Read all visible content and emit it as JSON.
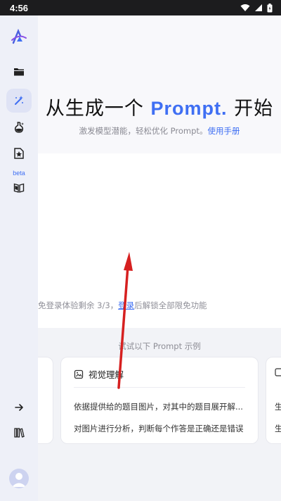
{
  "status_bar": {
    "time": "4:56"
  },
  "hero": {
    "title_prefix": "从生成一个 ",
    "title_accent": "Prompt.",
    "title_suffix": " 开始",
    "subtitle": "激发模型潜能，轻松优化 Prompt。",
    "manual_link": "使用手册"
  },
  "login_hint": {
    "prefix": "免登录体验剩余 3/3，",
    "login_link": "登录",
    "suffix": "后解锁全部限免功能"
  },
  "examples": {
    "title": "试试以下 Prompt 示例",
    "main_card": {
      "title": "视觉理解",
      "items": [
        "依据提供给的题目图片，对其中的题目展开解...",
        "对图片进行分析，判断每个作答是正确还是错误"
      ]
    },
    "right_card_peek": [
      "生",
      "生"
    ]
  },
  "sidebar": {
    "beta_label": "beta",
    "icons": [
      "logo-icon",
      "folder-icon",
      "magic-wand-icon",
      "flask-icon",
      "star-page-icon",
      "book-icon",
      "arrow-right-icon",
      "library-icon",
      "user-avatar-icon"
    ]
  },
  "colors": {
    "accent": "#3f6ff3",
    "annotation_arrow": "#d62020"
  }
}
